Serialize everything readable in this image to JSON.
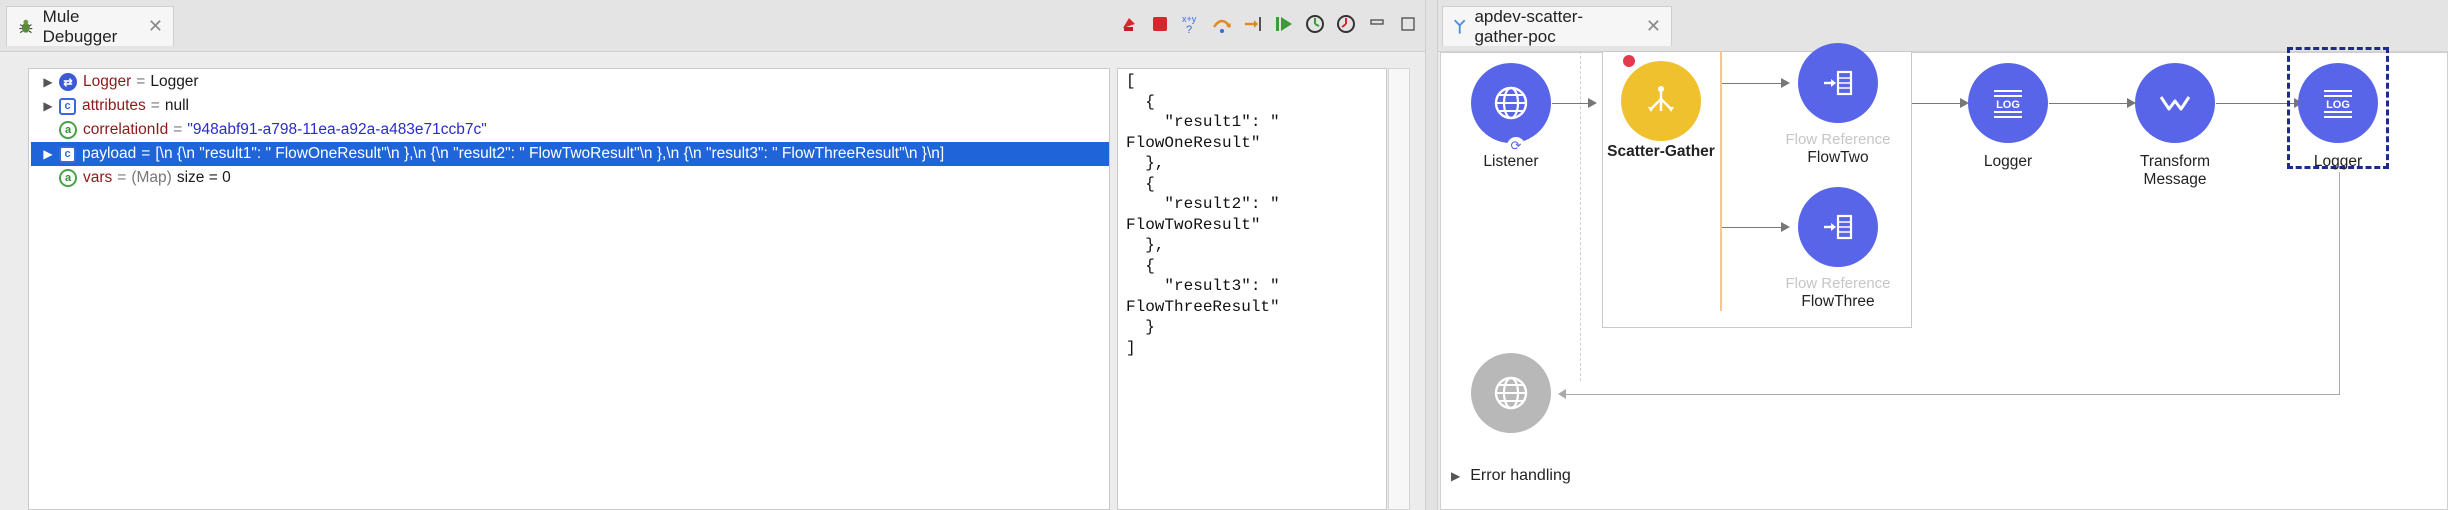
{
  "debugger": {
    "tab_title": "Mule Debugger",
    "close_glyph": "✕",
    "toolbar": [
      "terminate-icon",
      "stop-icon",
      "evaluate-expression-icon",
      "step-over-icon",
      "step-into-icon",
      "resume-icon",
      "run-to-processor-icon",
      "inspect-icon",
      "minimize-icon",
      "maximize-icon"
    ],
    "variables": [
      {
        "name": "Logger",
        "eq": "=",
        "value": "Logger",
        "icon": "object-icon",
        "expandable": true
      },
      {
        "name": "attributes",
        "eq": "=",
        "value": "null",
        "icon": "class-icon",
        "expandable": true
      },
      {
        "name": "correlationId",
        "eq": "=",
        "value": "\"948abf91-a798-11ea-a92a-a483e71ccb7c\"",
        "icon": "attribute-icon",
        "expandable": false
      },
      {
        "name": "payload",
        "eq": "=",
        "value": "[\\n {\\n    \"result1\": \" FlowOneResult\"\\n },\\n {\\n    \"result2\": \" FlowTwoResult\"\\n },\\n {\\n    \"result3\": \" FlowThreeResult\"\\n }\\n]",
        "icon": "class-icon",
        "expandable": true,
        "selected": true
      },
      {
        "name": "vars",
        "eq": "=",
        "type": "(Map)",
        "value": "size = 0",
        "icon": "attribute-icon",
        "expandable": false
      }
    ],
    "detail_text": "[\n  {\n    \"result1\": \"\nFlowOneResult\"\n  },\n  {\n    \"result2\": \"\nFlowTwoResult\"\n  },\n  {\n    \"result3\": \"\nFlowThreeResult\"\n  }\n]"
  },
  "editor": {
    "tab_title": "apdev-scatter-gather-poc",
    "close_glyph": "✕",
    "nodes": {
      "listener": {
        "label": "Listener",
        "icon": "globe-icon"
      },
      "scatter": {
        "label": "Scatter-Gather",
        "icon": "scatter-gather-icon"
      },
      "flow_two": {
        "sub": "Flow Reference",
        "label": "FlowTwo",
        "icon": "flow-reference-icon"
      },
      "flow_three": {
        "sub": "Flow Reference",
        "label": "FlowThree",
        "icon": "flow-reference-icon"
      },
      "logger1": {
        "label": "Logger",
        "icon": "log-icon"
      },
      "transform": {
        "label": "Transform\nMessage",
        "icon": "transform-icon"
      },
      "logger2": {
        "label": "Logger",
        "icon": "log-icon"
      },
      "response": {
        "icon": "globe-icon"
      }
    },
    "log_text": "LOG",
    "error_handling": "Error handling"
  },
  "colors": {
    "node_blue": "#5865e8",
    "node_gold": "#f0c12e",
    "selection": "#1f64d8"
  }
}
